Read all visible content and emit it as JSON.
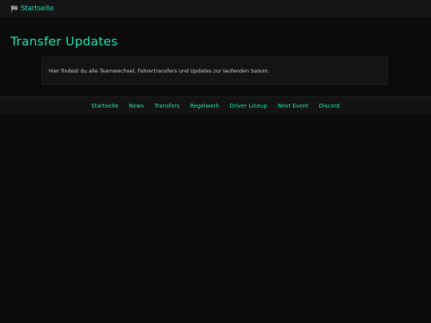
{
  "header": {
    "home_icon": "checkered-flag-icon",
    "home_label": "Startseite"
  },
  "main": {
    "title": "Transfer Updates",
    "intro": "Hier findest du alle Teamwechsel, Fahrertransfers und Updates zur laufenden Saison."
  },
  "nav": {
    "items": [
      {
        "label": "Startseite"
      },
      {
        "label": "News"
      },
      {
        "label": "Transfers"
      },
      {
        "label": "Regelwerk"
      },
      {
        "label": "Driver Lineup"
      },
      {
        "label": "Next Event"
      },
      {
        "label": "Discord"
      }
    ]
  },
  "colors": {
    "accent": "#22e6b4",
    "background": "#0b0b0b",
    "panel": "#141414"
  }
}
